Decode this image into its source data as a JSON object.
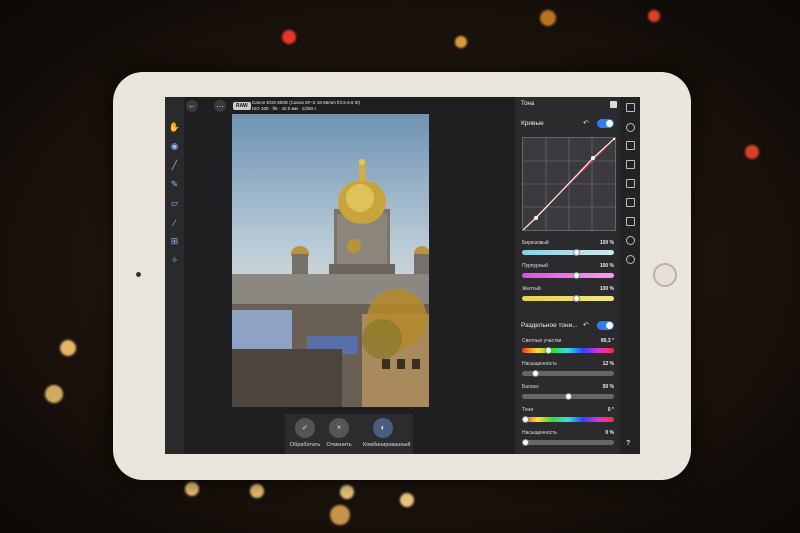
{
  "topbar": {
    "back_icon": "arrow-left-icon",
    "more_icon": "more-icon",
    "raw_badge": "RAW",
    "camera_line1": "Canon EOS 600D (Canon EF-S 18-55mm f/3.5-5.6 III)",
    "camera_line2": "ISO 100 · f/5 · 42.0 мм · 1/250 с"
  },
  "tools": [
    "hand-icon",
    "eye-icon",
    "brush-icon",
    "pencil-icon",
    "eraser-icon",
    "dropper-icon",
    "crop-icon",
    "wand-icon"
  ],
  "bottombar": {
    "apply_label": "Обработать",
    "cancel_label": "Отменить",
    "combined_label": "Комбинированный",
    "apply_glyph": "✓",
    "cancel_glyph": "×"
  },
  "panel": {
    "title": "Тона",
    "curves_label": "Кривые",
    "sliders1": [
      {
        "label": "Бирюзовый",
        "value": "100 %",
        "level": 0.6
      },
      {
        "label": "Пурпурный",
        "value": "100 %",
        "level": 0.6
      },
      {
        "label": "Желтый",
        "value": "100 %",
        "level": 0.6
      }
    ],
    "split_label": "Раздельное тони...",
    "sliders2": [
      {
        "label": "Светлые участки",
        "value": "89,3 °",
        "level": 0.27
      },
      {
        "label": "Насыщенность",
        "value": "12 %",
        "level": 0.12
      },
      {
        "label": "Баланс",
        "value": "50 %",
        "level": 0.5
      },
      {
        "label": "Тени",
        "value": "0 °",
        "level": 0.0
      },
      {
        "label": "Насыщенность",
        "value": "0 %",
        "level": 0.0
      }
    ],
    "help_label": "?"
  },
  "right_icons": [
    "tone-icon",
    "crop-square-icon",
    "grid-icon",
    "image-icon",
    "photo-icon",
    "layers-icon",
    "sparkle-icon",
    "history-icon"
  ],
  "colors": {
    "accent": "#2f7bf0",
    "panel_bg": "#2b2b2e",
    "tablet_frame": "#e9e4dc"
  }
}
